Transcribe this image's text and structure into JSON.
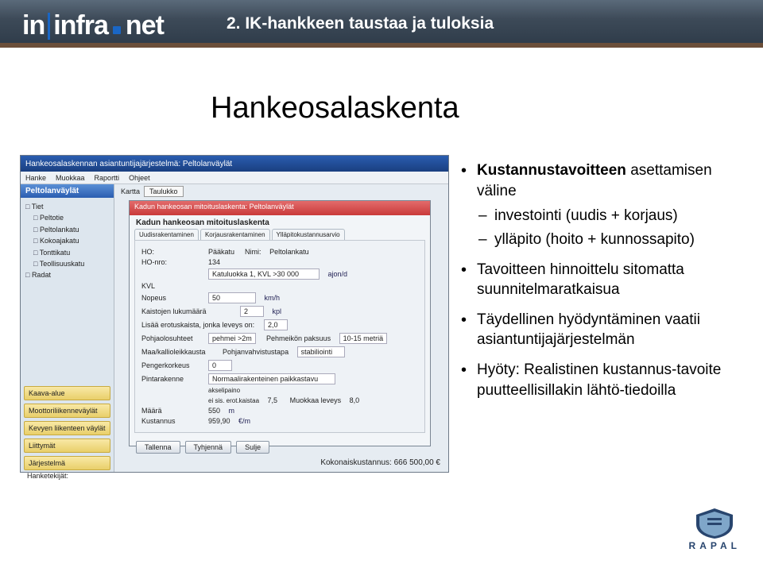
{
  "header": {
    "logo_in": "in",
    "logo_infra": "infra",
    "logo_net": "net",
    "subtitle": "2. IK-hankkeen taustaa ja tuloksia"
  },
  "title": "Hankeosalaskenta",
  "screenshot": {
    "app_title": "Hankeosalaskennan asiantuntijajärjestelmä: Peltolanväylät",
    "menu": [
      "Hanke",
      "Muokkaa",
      "Raportti",
      "Ohjeet"
    ],
    "side_head": "Peltolanväylät",
    "side_groups": {
      "tiet": "Tiet",
      "items": [
        "Peltotie",
        "Peltolankatu",
        "Kokoajakatu",
        "Tonttikatu",
        "Teollisuuskatu"
      ],
      "radat": "Radat"
    },
    "side_buttons": [
      "Kaava-alue",
      "Moottoriliikenneväylät",
      "Kevyen liikenteen väylät",
      "Liittymät",
      "Järjestelmä"
    ],
    "inner_title": "Kadun hankeosan mitoituslaskenta: Peltolanväylät",
    "inner_sub": "Kadun hankeosan mitoituslaskenta",
    "inner_tabs": [
      "Uudisrakentaminen",
      "Korjausrakentaminen",
      "Ylläpitokustannusarvio"
    ],
    "fields": {
      "ho": "HO:",
      "ho_val": "",
      "paakatu": "Pääkatu",
      "nimi": "Nimi:",
      "nimi_val": "Peltolankatu",
      "honro": "HO-nro:",
      "honro_val": "134",
      "katuluokka": "Katuluokka 1, KVL >30 000",
      "nopeus": "Nopeus",
      "nopeus_val": "50",
      "nopeus_unit": "km/h",
      "kvl": "KVL",
      "kvl_unit": "ajon/d",
      "kaistat": "Kaistojen lukumäärä",
      "kaistat_val": "2",
      "kaistat_unit": "kpl",
      "leveys_note": "Lisää erotuskaista, jonka leveys on:",
      "leveys_val": "2,0",
      "pohja": "Pohjaolosuhteet",
      "pohja_val": "pehmei >2m",
      "pehmpak": "Pehmeikön paksuus",
      "pehmpak_val": "10-15 metriä",
      "maakal": "Maa/kallioleikkausta",
      "vahv": "Pohjanvahvistustapa",
      "vahv_val": "stabiliointi",
      "penger": "Pengerkorkeus",
      "penger_val": "0",
      "pinta": "Pintarakenne",
      "pinta_val": "Normaalirakenteinen paikkastavu",
      "akselipaino": "akselipaino",
      "erot": "ei sis. erot.kaistaa",
      "erot_val": "7,5",
      "muokkaa": "Muokkaa leveys",
      "muokkaa_val": "8,0",
      "maara": "Määrä",
      "maara_val": "550",
      "maara_unit": "m",
      "kust": "Kustannus",
      "kust_val": "959,90",
      "kust_unit": "€/m"
    },
    "inner_buttons": [
      "Tallenna",
      "Tyhjennä",
      "Sulje"
    ],
    "footer_total": "Kokonaiskustannus: 666 500,00 €",
    "footer_label": "Hanketekijät:"
  },
  "bullets": {
    "b1_bold": "Kustannustavoitteen",
    "b1_rest": " asettamisen väline",
    "b1_sub1": "investointi (uudis + korjaus)",
    "b1_sub2": "ylläpito (hoito + kunnossapito)",
    "b2": "Tavoitteen hinnoittelu sitomatta suunnitelmaratkaisua",
    "b3": "Täydellinen hyödyntäminen vaatii asiantuntijajärjestelmän",
    "b4": "Hyöty: Realistinen kustannus-tavoite puutteellisillakin lähtö-tiedoilla"
  },
  "rapal": "RAPAL"
}
